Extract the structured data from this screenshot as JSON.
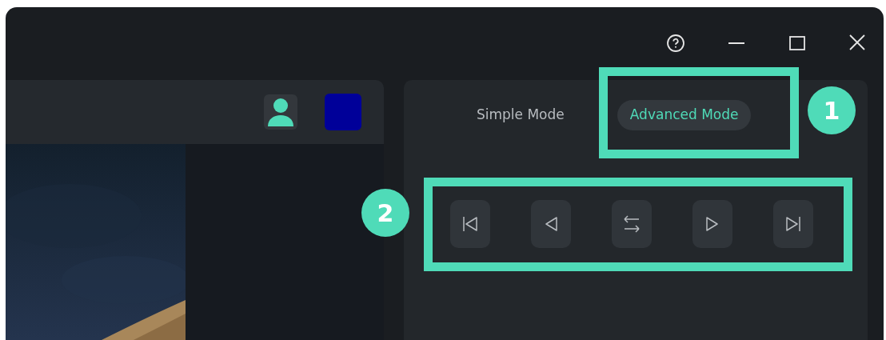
{
  "window_controls": [
    {
      "kind": "help"
    },
    {
      "kind": "minimize"
    },
    {
      "kind": "maximize"
    },
    {
      "kind": "close"
    }
  ],
  "toolbar": {
    "items": [
      {
        "kind": "avatar"
      },
      {
        "kind": "swatch",
        "color": "#000099"
      }
    ]
  },
  "modes": [
    {
      "label": "Simple Mode",
      "selected": false
    },
    {
      "label": "Advanced Mode",
      "selected": true
    }
  ],
  "playback": [
    {
      "kind": "first"
    },
    {
      "kind": "previous"
    },
    {
      "kind": "swap"
    },
    {
      "kind": "next"
    },
    {
      "kind": "last"
    }
  ],
  "annotations": [
    {
      "label": "1"
    },
    {
      "label": "2"
    }
  ]
}
